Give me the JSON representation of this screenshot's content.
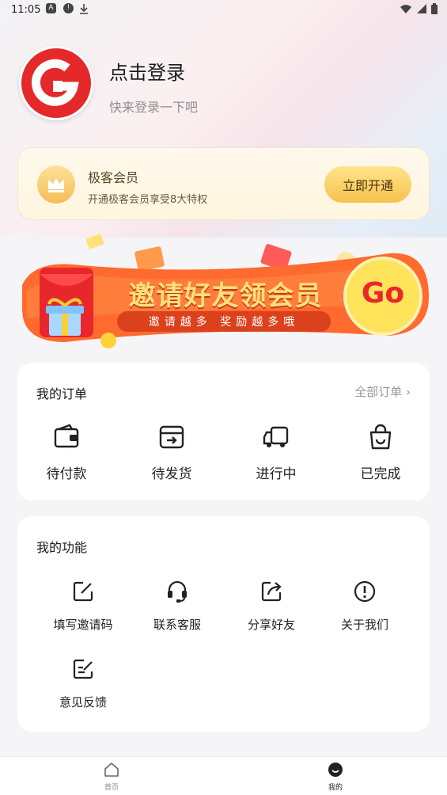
{
  "status_bar": {
    "time": "11:05"
  },
  "profile": {
    "title": "点击登录",
    "subtitle": "快来登录一下吧"
  },
  "vip": {
    "title": "极客会员",
    "subtitle": "开通极客会员享受8大特权",
    "button": "立即开通"
  },
  "banner": {
    "title": "邀请好友领会员",
    "subtitle": "邀请越多 奖励越多哦",
    "go": "Go"
  },
  "orders": {
    "title": "我的订单",
    "all_link": "全部订单",
    "items": [
      {
        "label": "待付款",
        "icon": "wallet-icon"
      },
      {
        "label": "待发货",
        "icon": "box-icon"
      },
      {
        "label": "进行中",
        "icon": "truck-icon"
      },
      {
        "label": "已完成",
        "icon": "bag-icon"
      }
    ]
  },
  "functions": {
    "title": "我的功能",
    "items": [
      {
        "label": "填写邀请码",
        "icon": "edit-icon"
      },
      {
        "label": "联系客服",
        "icon": "headset-icon"
      },
      {
        "label": "分享好友",
        "icon": "share-icon"
      },
      {
        "label": "关于我们",
        "icon": "info-icon"
      },
      {
        "label": "意见反馈",
        "icon": "feedback-icon"
      }
    ]
  },
  "tabbar": {
    "home": "首页",
    "mine": "我的"
  },
  "colors": {
    "brand": "#e5292b",
    "gold": "#f6c24c",
    "banner_orange": "#ff5a2b"
  }
}
